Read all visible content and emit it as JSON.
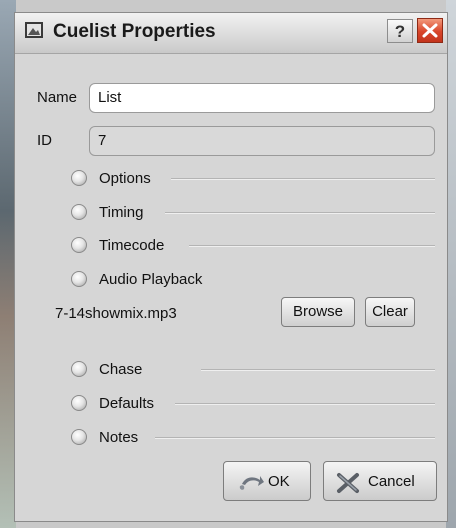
{
  "window": {
    "title": "Cuelist Properties",
    "help_label": "?"
  },
  "form": {
    "name_label": "Name",
    "name_value": "List",
    "id_label": "ID",
    "id_value": "7"
  },
  "sections": [
    {
      "label": "Options"
    },
    {
      "label": "Timing"
    },
    {
      "label": "Timecode"
    },
    {
      "label": "Audio Playback"
    },
    {
      "label": "Chase"
    },
    {
      "label": "Defaults"
    },
    {
      "label": "Notes"
    }
  ],
  "audio": {
    "file_name": "7-14showmix.mp3",
    "browse_label": "Browse",
    "clear_label": "Clear"
  },
  "buttons": {
    "ok_label": "OK",
    "cancel_label": "Cancel"
  }
}
